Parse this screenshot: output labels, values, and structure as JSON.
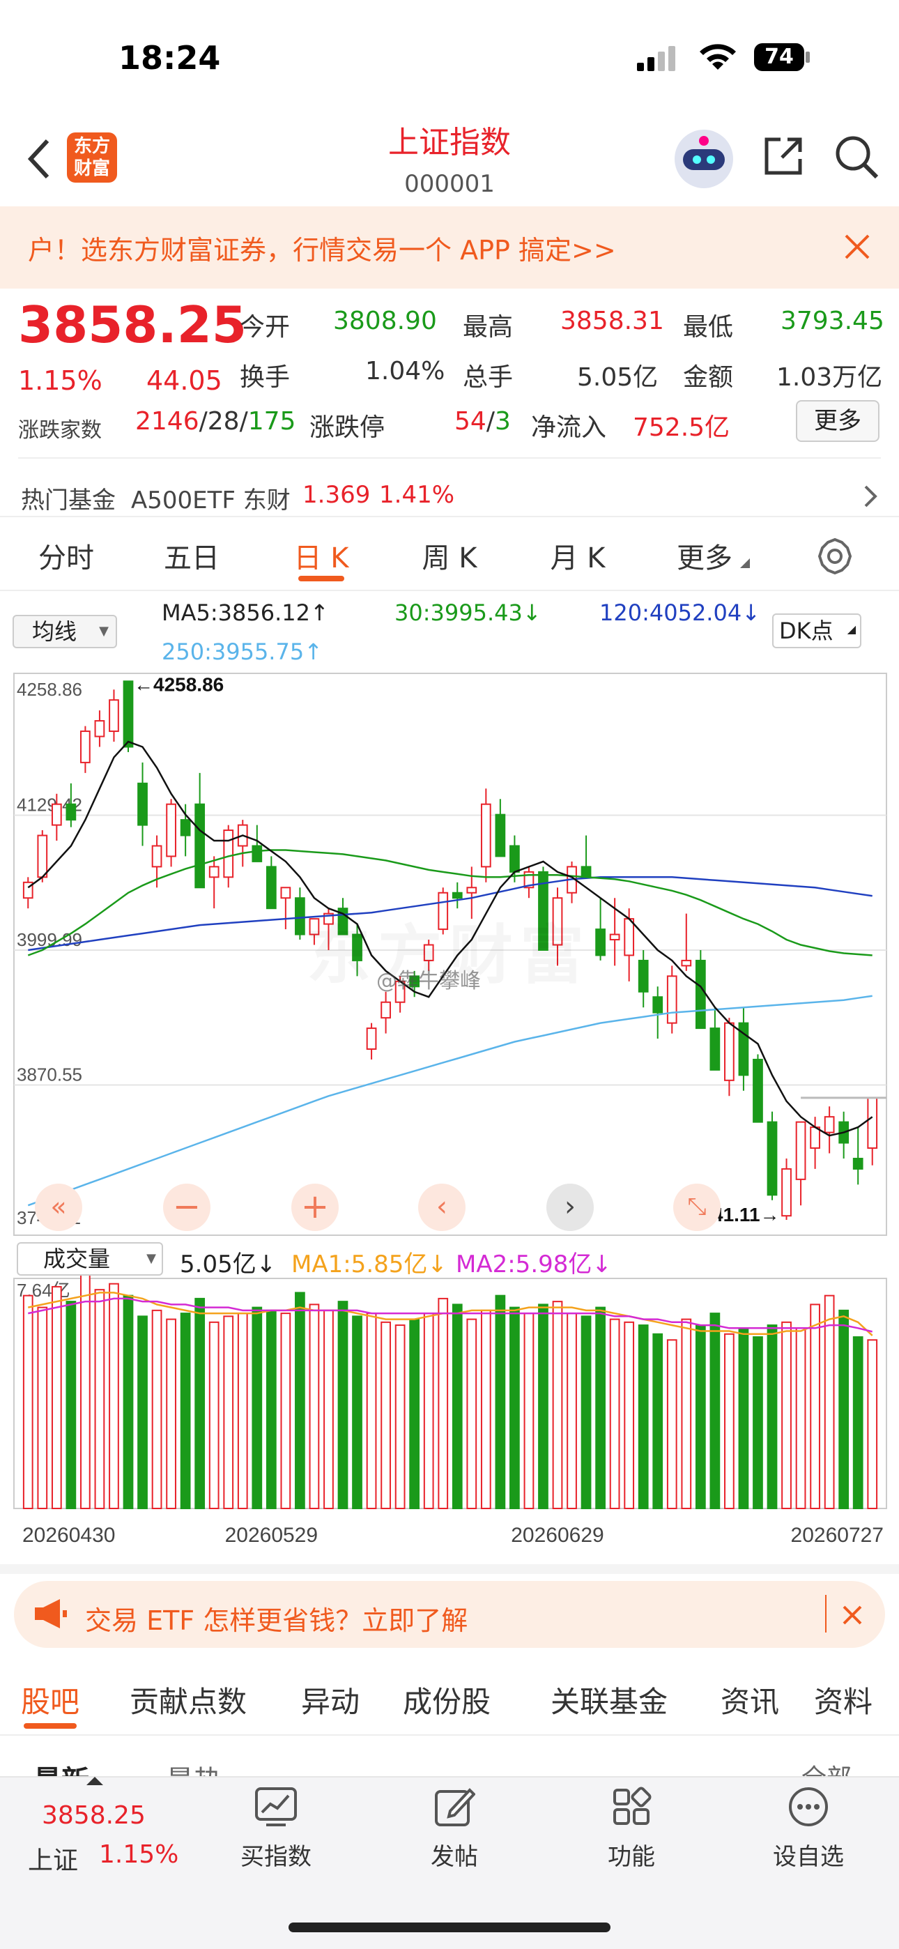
{
  "status_bar": {
    "time": "18:24",
    "battery": "74"
  },
  "header": {
    "title": "上证指数",
    "code": "000001",
    "logo": "东方财富"
  },
  "promo": {
    "text": "户！选东方财富证券，行情交易一个 APP 搞定>>"
  },
  "quote": {
    "price": "3858.25",
    "change_pct": "1.15%",
    "change": "44.05",
    "open_label": "今开",
    "open": "3808.90",
    "high_label": "最高",
    "high": "3858.31",
    "low_label": "最低",
    "low": "3793.45",
    "turnover_label": "换手",
    "turnover": "1.04%",
    "vol_label": "总手",
    "vol": "5.05亿",
    "amount_label": "金额",
    "amount": "1.03万亿",
    "adv_label": "涨跌家数",
    "adv_up": "2146",
    "adv_flat": "28",
    "adv_down": "175",
    "limit_label": "涨跌停",
    "limit_up": "54",
    "limit_down": "3",
    "inflow_label": "净流入",
    "inflow": "752.5亿",
    "more": "更多"
  },
  "hot_fund": {
    "label": "热门基金",
    "name": "A500ETF 东财",
    "price": "1.369",
    "pct": "1.41%"
  },
  "tabs": [
    "分时",
    "五日",
    "日 K",
    "周 K",
    "月 K",
    "更多"
  ],
  "active_tab": "日 K",
  "ma_bar": {
    "select": "均线",
    "ma5": "MA5:3856.12",
    "ma30": "30:3995.43",
    "ma120": "120:4052.04",
    "ma250": "250:3955.75",
    "dk": "DK点"
  },
  "arrows": {
    "up": "↑",
    "down": "↓",
    "left": "←",
    "right": "→"
  },
  "chart_labels": {
    "max_marker": "4258.86",
    "min_marker": "3741.11"
  },
  "vol_bar": {
    "select": "成交量",
    "vol": "5.05亿",
    "ma1": "MA1:5.85亿",
    "ma2": "MA2:5.98亿"
  },
  "watermark": "@犇牛攀峰",
  "chart_data": {
    "type": "candlestick",
    "y_axis_labels": [
      "4258.86",
      "4129.42",
      "3999.99",
      "3870.55",
      "3741.11"
    ],
    "ylim": [
      3741.11,
      4258.86
    ],
    "volume_max_label": "7.64亿",
    "x_labels": [
      "20260430",
      "20260529",
      "20260629",
      "20260727"
    ],
    "ohlc": [
      [
        4050,
        4070,
        4040,
        4065
      ],
      [
        4070,
        4115,
        4065,
        4110
      ],
      [
        4120,
        4150,
        4105,
        4140
      ],
      [
        4140,
        4160,
        4118,
        4125
      ],
      [
        4180,
        4215,
        4170,
        4210
      ],
      [
        4205,
        4230,
        4195,
        4220
      ],
      [
        4210,
        4250,
        4200,
        4240
      ],
      [
        4258,
        4258,
        4190,
        4195
      ],
      [
        4160,
        4180,
        4100,
        4120
      ],
      [
        4080,
        4110,
        4060,
        4100
      ],
      [
        4090,
        4145,
        4080,
        4140
      ],
      [
        4125,
        4140,
        4090,
        4110
      ],
      [
        4140,
        4170,
        4060,
        4060
      ],
      [
        4070,
        4090,
        4040,
        4080
      ],
      [
        4070,
        4120,
        4060,
        4115
      ],
      [
        4100,
        4125,
        4080,
        4120
      ],
      [
        4100,
        4120,
        4085,
        4085
      ],
      [
        4080,
        4090,
        4040,
        4040
      ],
      [
        4050,
        4060,
        4020,
        4060
      ],
      [
        4050,
        4060,
        4010,
        4015
      ],
      [
        4015,
        4030,
        4005,
        4030
      ],
      [
        4025,
        4040,
        4000,
        4035
      ],
      [
        4040,
        4050,
        4015,
        4015
      ],
      [
        4015,
        4025,
        3975,
        3990
      ],
      [
        3905,
        3930,
        3895,
        3925
      ],
      [
        3935,
        3960,
        3920,
        3950
      ],
      [
        3950,
        3975,
        3940,
        3970
      ],
      [
        3975,
        3980,
        3955,
        3965
      ],
      [
        3990,
        4010,
        3980,
        4005
      ],
      [
        4020,
        4060,
        4015,
        4055
      ],
      [
        4055,
        4065,
        4040,
        4050
      ],
      [
        4055,
        4080,
        4030,
        4060
      ],
      [
        4080,
        4155,
        4065,
        4140
      ],
      [
        4130,
        4145,
        4090,
        4090
      ],
      [
        4100,
        4110,
        4065,
        4075
      ],
      [
        4060,
        4080,
        4050,
        4075
      ],
      [
        4075,
        4080,
        4000,
        4000
      ],
      [
        4005,
        4060,
        3985,
        4050
      ],
      [
        4055,
        4085,
        4045,
        4080
      ],
      [
        4080,
        4110,
        4070,
        4070
      ],
      [
        4020,
        4050,
        3990,
        3995
      ],
      [
        4010,
        4050,
        3985,
        4015
      ],
      [
        3995,
        4040,
        3970,
        4030
      ],
      [
        3990,
        4000,
        3945,
        3960
      ],
      [
        3955,
        3965,
        3915,
        3940
      ],
      [
        3930,
        3985,
        3920,
        3975
      ],
      [
        3985,
        4035,
        3980,
        3990
      ],
      [
        3990,
        4000,
        3925,
        3925
      ],
      [
        3925,
        3945,
        3885,
        3885
      ],
      [
        3875,
        3935,
        3860,
        3930
      ],
      [
        3930,
        3945,
        3865,
        3880
      ],
      [
        3895,
        3900,
        3835,
        3835
      ],
      [
        3835,
        3845,
        3760,
        3765
      ],
      [
        3745,
        3800,
        3741.11,
        3790
      ],
      [
        3780,
        3835,
        3755,
        3835
      ],
      [
        3810,
        3840,
        3790,
        3830
      ],
      [
        3825,
        3850,
        3805,
        3840
      ],
      [
        3835,
        3845,
        3800,
        3815
      ],
      [
        3800,
        3830,
        3775,
        3790
      ],
      [
        3810,
        3858.31,
        3793.45,
        3858.25
      ]
    ],
    "ma5": [
      4060,
      4070,
      4085,
      4100,
      4125,
      4155,
      4185,
      4200,
      4195,
      4175,
      4150,
      4130,
      4115,
      4105,
      4105,
      4110,
      4105,
      4095,
      4085,
      4070,
      4050,
      4040,
      4035,
      4025,
      3995,
      3980,
      3970,
      3960,
      3955,
      3975,
      3995,
      4010,
      4035,
      4060,
      4075,
      4080,
      4085,
      4075,
      4070,
      4060,
      4050,
      4040,
      4030,
      4015,
      4000,
      3990,
      3975,
      3965,
      3945,
      3930,
      3920,
      3910,
      3880,
      3855,
      3840,
      3830,
      3822,
      3825,
      3830,
      3840
    ],
    "ma30": [
      3995,
      4000,
      4008,
      4016,
      4025,
      4035,
      4045,
      4055,
      4062,
      4068,
      4073,
      4078,
      4082,
      4086,
      4090,
      4093,
      4095,
      4096,
      4096,
      4095,
      4094,
      4093,
      4092,
      4090,
      4088,
      4086,
      4083,
      4080,
      4077,
      4075,
      4073,
      4071,
      4070,
      4070,
      4071,
      4072,
      4072,
      4072,
      4071,
      4070,
      4069,
      4068,
      4066,
      4063,
      4060,
      4057,
      4053,
      4048,
      4042,
      4036,
      4030,
      4025,
      4018,
      4010,
      4005,
      4002,
      3999,
      3997,
      3996,
      3995
    ],
    "ma120": [
      4000,
      4002,
      4004,
      4006,
      4008,
      4010,
      4012,
      4014,
      4016,
      4018,
      4020,
      4022,
      4024,
      4025,
      4026,
      4027,
      4028,
      4029,
      4030,
      4031,
      4032,
      4033,
      4034,
      4035,
      4036,
      4038,
      4040,
      4042,
      4044,
      4046,
      4048,
      4050,
      4053,
      4056,
      4059,
      4062,
      4064,
      4066,
      4068,
      4069,
      4070,
      4070,
      4070,
      4070,
      4070,
      4070,
      4069,
      4068,
      4067,
      4066,
      4065,
      4064,
      4063,
      4062,
      4061,
      4060,
      4058,
      4056,
      4054,
      4052
    ],
    "ma250": [
      3755,
      3760,
      3765,
      3770,
      3775,
      3780,
      3785,
      3790,
      3795,
      3800,
      3805,
      3810,
      3815,
      3820,
      3825,
      3830,
      3835,
      3840,
      3845,
      3850,
      3855,
      3860,
      3864,
      3868,
      3872,
      3876,
      3880,
      3884,
      3888,
      3892,
      3896,
      3900,
      3904,
      3908,
      3912,
      3915,
      3918,
      3921,
      3924,
      3927,
      3930,
      3932,
      3934,
      3936,
      3938,
      3940,
      3941,
      3942,
      3943,
      3944,
      3945,
      3946,
      3947,
      3948,
      3949,
      3950,
      3951,
      3952,
      3954,
      3956
    ],
    "volume": [
      7.2,
      6.8,
      7.5,
      7.0,
      7.9,
      7.4,
      7.6,
      7.2,
      6.5,
      6.7,
      6.4,
      6.6,
      7.1,
      6.3,
      6.5,
      6.6,
      6.8,
      6.7,
      6.6,
      7.3,
      6.9,
      6.7,
      7.0,
      6.5,
      6.6,
      6.3,
      6.2,
      6.4,
      6.6,
      7.1,
      6.9,
      6.4,
      6.7,
      7.2,
      6.8,
      6.6,
      6.9,
      7.0,
      6.6,
      6.5,
      6.8,
      6.4,
      6.3,
      6.2,
      5.9,
      5.7,
      6.4,
      6.2,
      6.6,
      5.9,
      6.1,
      5.8,
      6.2,
      6.3,
      6.1,
      6.9,
      7.2,
      6.7,
      5.8,
      5.7
    ],
    "volume_ma1": [
      6.8,
      6.9,
      7.0,
      7.1,
      7.2,
      7.3,
      7.3,
      7.2,
      7.1,
      6.9,
      6.8,
      6.7,
      6.6,
      6.6,
      6.6,
      6.6,
      6.6,
      6.7,
      6.7,
      6.8,
      6.7,
      6.7,
      6.7,
      6.6,
      6.5,
      6.4,
      6.4,
      6.4,
      6.5,
      6.6,
      6.6,
      6.7,
      6.7,
      6.7,
      6.7,
      6.8,
      6.8,
      6.8,
      6.8,
      6.7,
      6.7,
      6.6,
      6.5,
      6.4,
      6.3,
      6.2,
      6.1,
      6.0,
      6.0,
      6.0,
      5.9,
      5.9,
      5.9,
      6.0,
      6.0,
      6.2,
      6.4,
      6.5,
      6.3,
      5.85
    ],
    "volume_ma2": [
      6.6,
      6.7,
      6.8,
      6.9,
      7.0,
      7.0,
      7.1,
      7.1,
      7.0,
      7.0,
      6.9,
      6.9,
      6.8,
      6.8,
      6.8,
      6.7,
      6.7,
      6.7,
      6.7,
      6.7,
      6.7,
      6.7,
      6.7,
      6.7,
      6.6,
      6.6,
      6.6,
      6.6,
      6.6,
      6.6,
      6.6,
      6.6,
      6.6,
      6.6,
      6.6,
      6.6,
      6.6,
      6.6,
      6.6,
      6.6,
      6.6,
      6.5,
      6.5,
      6.4,
      6.4,
      6.3,
      6.3,
      6.2,
      6.2,
      6.1,
      6.1,
      6.1,
      6.1,
      6.1,
      6.1,
      6.1,
      6.2,
      6.2,
      6.1,
      5.98
    ]
  },
  "ad2": {
    "text": "交易 ETF 怎样更省钱？立即了解"
  },
  "sub_tabs": [
    "股吧",
    "贡献点数",
    "异动",
    "成份股",
    "关联基金",
    "资讯",
    "资料"
  ],
  "hidden_row": {
    "left": "最新",
    "mid": "最热",
    "right": "全部"
  },
  "bottom_bar": {
    "price": "3858.25",
    "name": "上证",
    "pct": "1.15%",
    "items": [
      "买指数",
      "发帖",
      "功能",
      "设自选"
    ]
  }
}
